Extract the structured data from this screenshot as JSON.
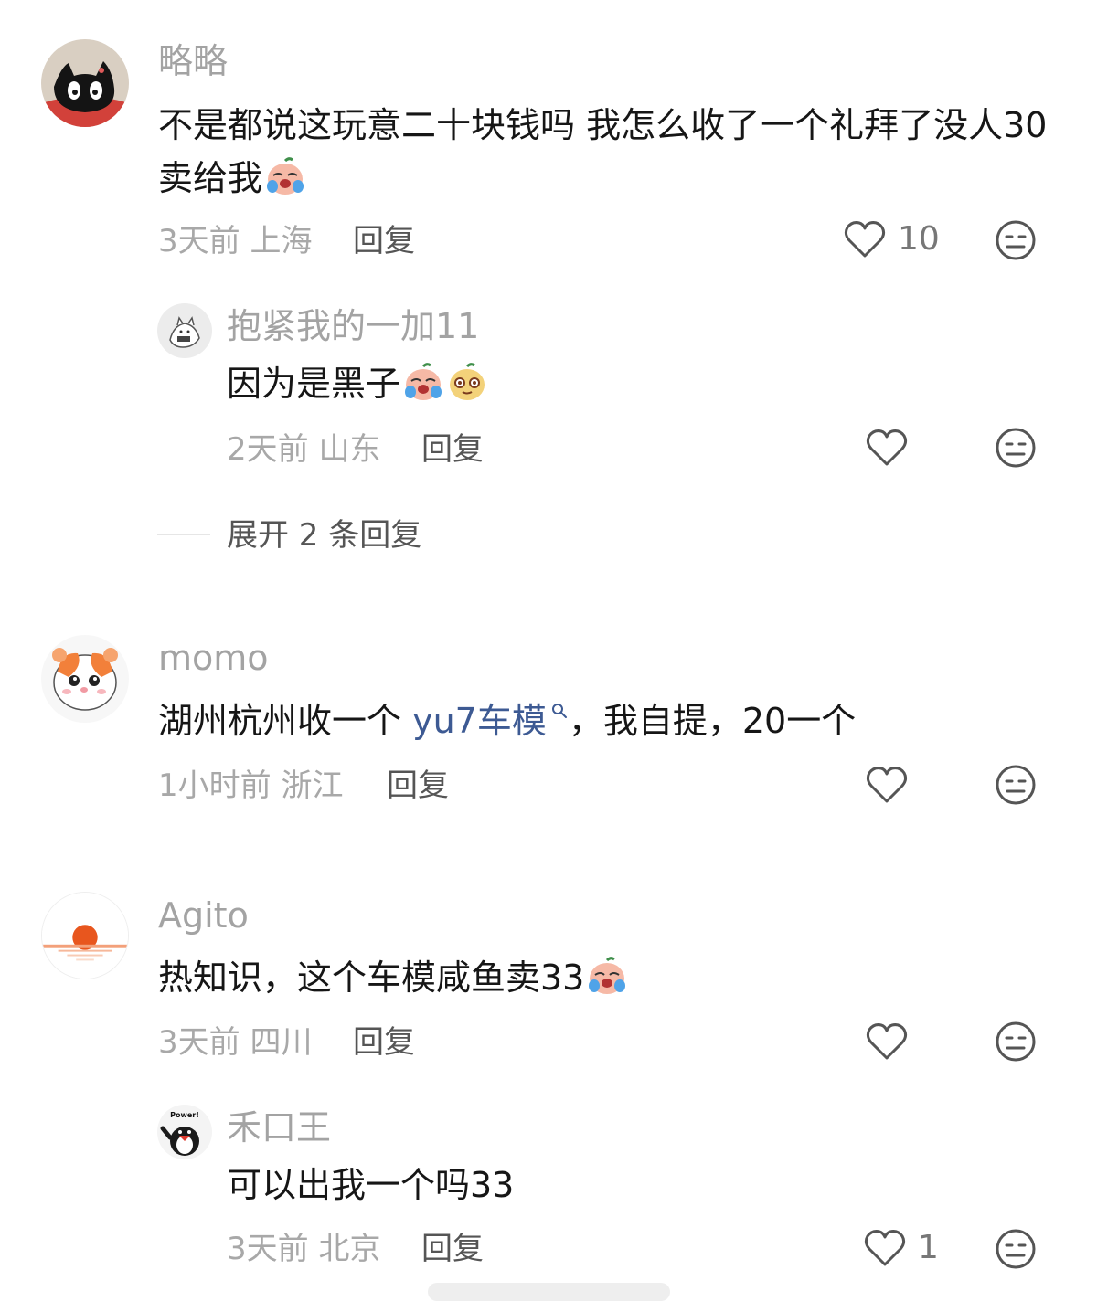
{
  "comments": [
    {
      "username": "略略",
      "text": "不是都说这玩意二十块钱吗 我怎么收了一个礼拜了没人30卖给我",
      "time": "3天前",
      "location": "上海",
      "reply_label": "回复",
      "likes": "10",
      "emojis": [
        "crying-peach"
      ],
      "avatar": "black-cat"
    },
    {
      "username": "抱紧我的一加11",
      "text": "因为是黑子",
      "time": "2天前",
      "location": "山东",
      "reply_label": "回复",
      "likes": "",
      "emojis": [
        "crying-peach",
        "smug-peach"
      ],
      "avatar": "doodle-cat"
    },
    {
      "username": "momo",
      "text_prefix": "湖州杭州收一个 ",
      "link_text": "yu7车模",
      "text_suffix": "，我自提，20一个",
      "time": "1小时前",
      "location": "浙江",
      "reply_label": "回复",
      "likes": "",
      "avatar": "hamster"
    },
    {
      "username": "Agito",
      "text": "热知识，这个车模咸鱼卖33",
      "time": "3天前",
      "location": "四川",
      "reply_label": "回复",
      "likes": "",
      "emojis": [
        "crying-peach"
      ],
      "avatar": "sunset"
    },
    {
      "username": "禾口王",
      "text": "可以出我一个吗33",
      "time": "3天前",
      "location": "北京",
      "reply_label": "回复",
      "likes": "1",
      "avatar": "penguin-power",
      "avatar_text": "Power!"
    }
  ],
  "expand_replies": "展开 2 条回复",
  "colors": {
    "username": "#a3a3a3",
    "text": "#161616",
    "meta": "#a8a8a8",
    "link": "#3d5a93"
  }
}
